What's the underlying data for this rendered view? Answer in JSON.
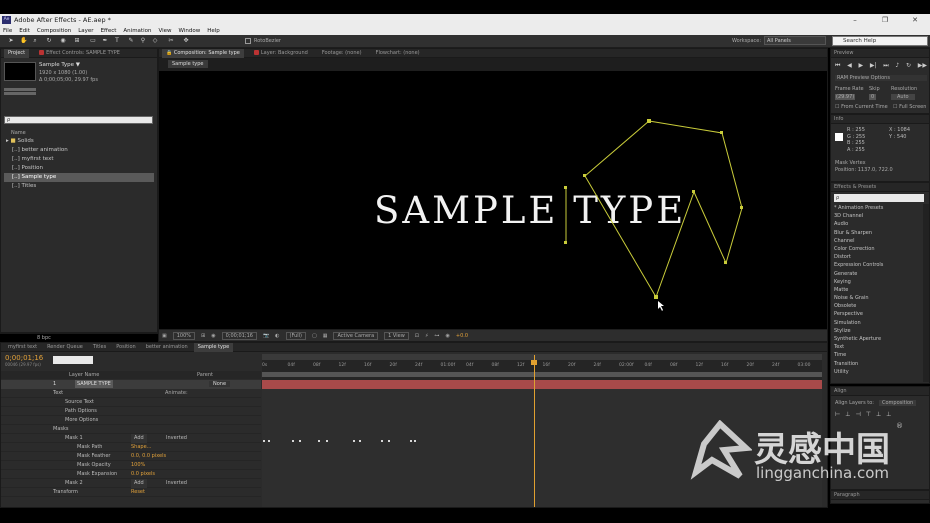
{
  "window": {
    "title": "Adobe After Effects - AE.aep *",
    "app_badge": "Ae",
    "minimize": "–",
    "maximize": "❐",
    "close": "✕"
  },
  "menu": [
    "File",
    "Edit",
    "Composition",
    "Layer",
    "Effect",
    "Animation",
    "View",
    "Window",
    "Help"
  ],
  "toolbar": {
    "rotobezier_label": "RotoBezier",
    "workspace_label": "Workspace:",
    "workspace_value": "All Panels",
    "search_placeholder": "Search Help"
  },
  "project": {
    "tab_project": "Project",
    "tab_effect_controls": "Effect Controls: SAMPLE TYPE",
    "selected_name": "Sample Type ▼",
    "selected_dims": "1920 x 1080 (1.00)",
    "selected_duration": "Δ 0;00;05;00, 29.97 fps",
    "search_placeholder": "ρ",
    "col_name": "Name",
    "folder": "Solids",
    "items": [
      "better animation",
      "myfirst text",
      "Position",
      "Sample type",
      "Titles"
    ],
    "bpc": "8 bpc"
  },
  "composition": {
    "tab_label": "Composition: Sample type",
    "layer_tab": "Layer: Background",
    "footage_tab": "Footage: (none)",
    "flowchart_tab": "Flowchart: (none)",
    "sub_tab": "Sample type",
    "canvas_text": "SAMPLE TYPE",
    "zoom": "100%",
    "time": "0;00;01;16",
    "quality": "(Full)",
    "camera": "Active Camera",
    "views": "1 View",
    "exposure": "+0.0"
  },
  "right": {
    "preview": {
      "title": "Preview",
      "ram_options": "RAM Preview Options",
      "frame_rate_label": "Frame Rate",
      "skip_label": "Skip",
      "resolution_label": "Resolution",
      "frame_rate": "(29.97)",
      "skip": "0",
      "resolution": "Auto",
      "from_current": "From Current Time",
      "full_screen": "Full Screen"
    },
    "info": {
      "title": "Info",
      "r": "R : 255",
      "g": "G : 255",
      "b": "B : 255",
      "a": "A : 255",
      "x": "X : 1084",
      "y": "Y : 540",
      "mask_label": "Mask Vertex",
      "position": "Position: 1137.0, 722.0"
    },
    "effects": {
      "title": "Effects & Presets",
      "search": "ρ",
      "items": [
        "* Animation Presets",
        "3D Channel",
        "Audio",
        "Blur & Sharpen",
        "Channel",
        "Color Correction",
        "Distort",
        "Expression Controls",
        "Generate",
        "Keying",
        "Matte",
        "Noise & Grain",
        "Obsolete",
        "Perspective",
        "Simulation",
        "Stylize",
        "Synthetic Aperture",
        "Text",
        "Time",
        "Transition",
        "Utility"
      ]
    },
    "align": {
      "title": "Align",
      "align_to_label": "Align Layers to:",
      "align_to_value": "Composition"
    },
    "paragraph": {
      "title": "Paragraph"
    }
  },
  "timeline": {
    "tabs": [
      "myfirst text",
      "Render Queue",
      "Titles",
      "Position",
      "better animation",
      "Sample type"
    ],
    "current_time": "0;00;01;16",
    "fps_info": "00046 (29.97 fps)",
    "col_layer_name": "Layer Name",
    "col_parent": "Parent",
    "parent_value": "None",
    "ruler": [
      "0s",
      "04f",
      "08f",
      "12f",
      "16f",
      "20f",
      "24f",
      "01:00f",
      "04f",
      "08f",
      "12f",
      "16f",
      "20f",
      "24f",
      "02:00f",
      "04f",
      "08f",
      "12f",
      "16f",
      "20f",
      "24f",
      "03:00"
    ],
    "layer_number": "1",
    "layer_name": "SAMPLE TYPE",
    "animate_label": "Animate:",
    "rows": [
      {
        "label": "Text",
        "indent": 1
      },
      {
        "label": "Source Text",
        "indent": 2
      },
      {
        "label": "Path Options",
        "indent": 2
      },
      {
        "label": "More Options",
        "indent": 2
      },
      {
        "label": "Masks",
        "indent": 1
      },
      {
        "label": "Mask 1",
        "indent": 2,
        "mode": "Add",
        "inverted": "Inverted"
      },
      {
        "label": "Mask Path",
        "indent": 3,
        "value": "Shape..."
      },
      {
        "label": "Mask Feather",
        "indent": 3,
        "value": "0.0, 0.0 pixels"
      },
      {
        "label": "Mask Opacity",
        "indent": 3,
        "value": "100%"
      },
      {
        "label": "Mask Expansion",
        "indent": 3,
        "value": "0.0 pixels"
      },
      {
        "label": "Mask 2",
        "indent": 2,
        "mode": "Add",
        "inverted": "Inverted"
      },
      {
        "label": "Transform",
        "indent": 1,
        "value": "Reset"
      }
    ]
  },
  "watermark": {
    "brand": "灵感中国",
    "url": "lingganchina.com",
    "registered": "®"
  },
  "colors": {
    "mask": "#c9cc3a",
    "playhead": "#e0a030",
    "accent": "#e1a13a"
  }
}
